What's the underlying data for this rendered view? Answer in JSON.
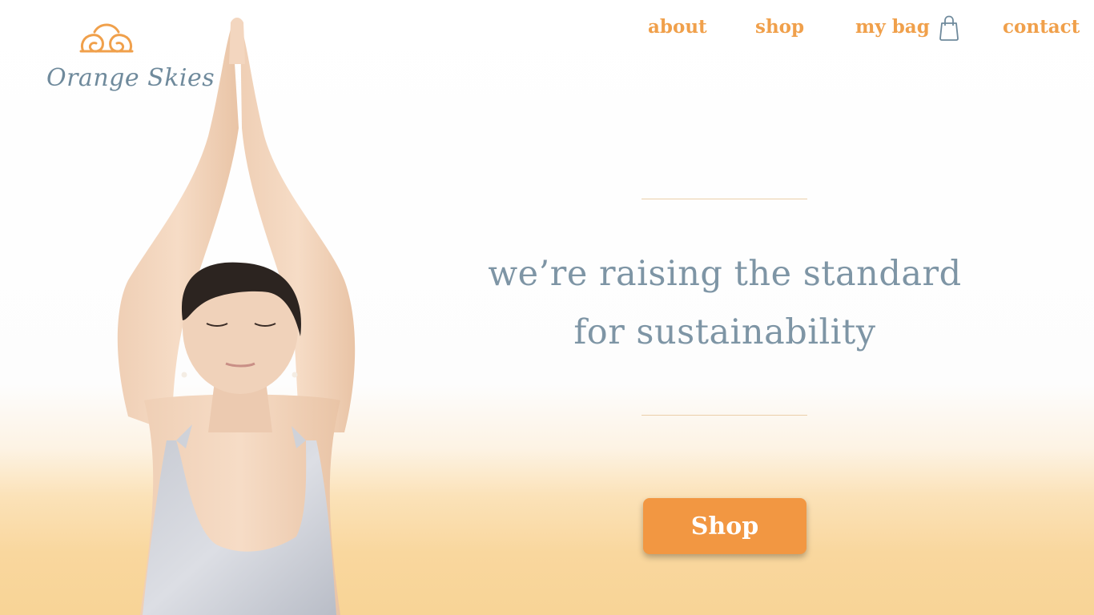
{
  "brand": {
    "name": "Orange Skies",
    "accent_color": "#f0a04b",
    "logo_text_color": "#6f8a9c"
  },
  "nav": {
    "about": "about",
    "shop": "shop",
    "bag": "my bag",
    "bag_icon": "shopping-bag-icon",
    "contact": "contact"
  },
  "hero": {
    "line1": "we’re raising the standard",
    "line2": "for sustainability",
    "text_color": "#7e95a5",
    "cta_label": "Shop",
    "cta_color": "#f29742"
  },
  "background": {
    "top_color": "#ffffff",
    "bottom_color": "#f8d496"
  }
}
